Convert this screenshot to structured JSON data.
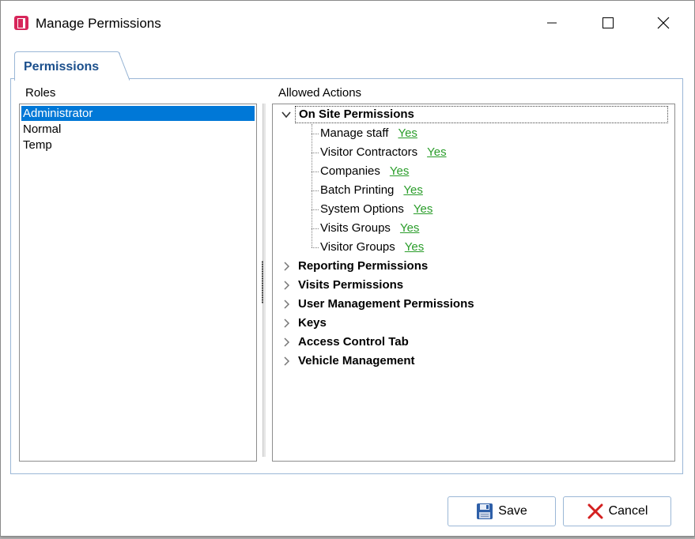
{
  "window": {
    "title": "Manage Permissions",
    "icon": "app-door-icon",
    "accent": "#d7265b"
  },
  "tab": {
    "label": "Permissions"
  },
  "roles": {
    "label": "Roles",
    "items": [
      "Administrator",
      "Normal",
      "Temp"
    ],
    "selected": "Administrator"
  },
  "actions": {
    "label": "Allowed Actions",
    "groups": [
      {
        "label": "On Site Permissions",
        "expanded": true,
        "children": [
          {
            "label": "Manage staff",
            "value": "Yes"
          },
          {
            "label": "Visitor Contractors",
            "value": "Yes"
          },
          {
            "label": "Companies",
            "value": "Yes"
          },
          {
            "label": "Batch Printing",
            "value": "Yes"
          },
          {
            "label": "System Options",
            "value": "Yes"
          },
          {
            "label": "Visits Groups",
            "value": "Yes"
          },
          {
            "label": "Visitor Groups",
            "value": "Yes"
          }
        ]
      },
      {
        "label": "Reporting Permissions",
        "expanded": false
      },
      {
        "label": "Visits Permissions",
        "expanded": false
      },
      {
        "label": "User Management Permissions",
        "expanded": false
      },
      {
        "label": "Keys",
        "expanded": false
      },
      {
        "label": "Access Control Tab",
        "expanded": false
      },
      {
        "label": "Vehicle Management",
        "expanded": false
      }
    ]
  },
  "buttons": {
    "save": "Save",
    "cancel": "Cancel"
  },
  "colors": {
    "selection": "#0078d7",
    "yes_link": "#2a9d2a",
    "tab_text": "#1b4f8c",
    "border": "#9bb7d6"
  }
}
